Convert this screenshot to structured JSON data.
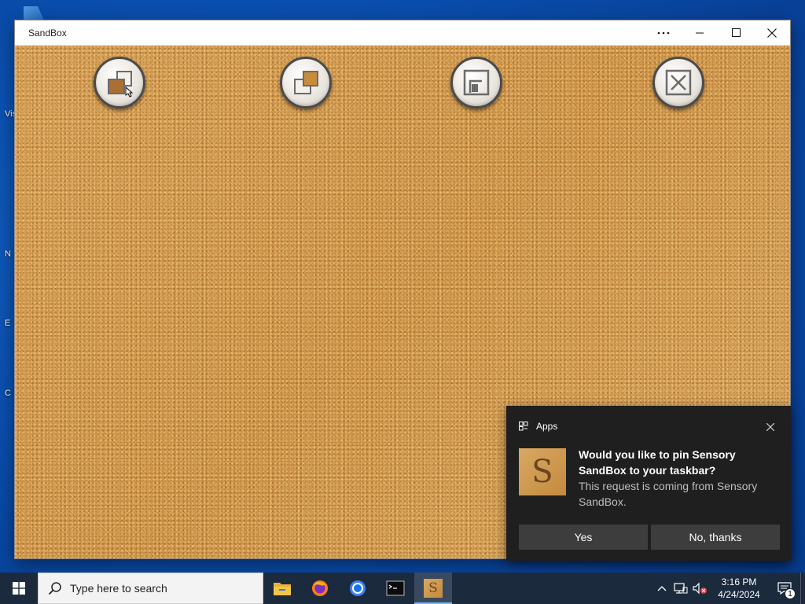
{
  "desktop": {
    "icon_fragments": [
      "Vis",
      "N",
      "E",
      "C"
    ]
  },
  "window": {
    "title": "SandBox",
    "controls": {
      "more": "more-options",
      "minimize": "minimize",
      "maximize": "maximize",
      "close": "close"
    },
    "buttons": [
      {
        "name": "swap-layers",
        "icon": "layers-back-icon"
      },
      {
        "name": "bring-forward",
        "icon": "layers-front-icon"
      },
      {
        "name": "resize-window",
        "icon": "resize-icon"
      },
      {
        "name": "close-app",
        "icon": "x-box-icon"
      }
    ],
    "background": "cork-board"
  },
  "toast": {
    "app": "Apps",
    "title": "Would you like to pin Sensory SandBox to your taskbar?",
    "body": "This request is coming from Sensory SandBox.",
    "icon_letter": "S",
    "yes": "Yes",
    "no": "No, thanks"
  },
  "taskbar": {
    "search_placeholder": "Type here to search",
    "apps": [
      "file-explorer",
      "firefox",
      "chrome",
      "terminal",
      "sensory-sandbox"
    ],
    "active_app": "sensory-sandbox",
    "app_letter": "S",
    "time": "3:16 PM",
    "date": "4/24/2024",
    "notification_count": "1"
  },
  "colors": {
    "toast_bg": "#1f1f1f",
    "toast_button": "#3d3d3d",
    "taskbar_bg": "#1b2a3d",
    "cork": "#d29a4f"
  }
}
